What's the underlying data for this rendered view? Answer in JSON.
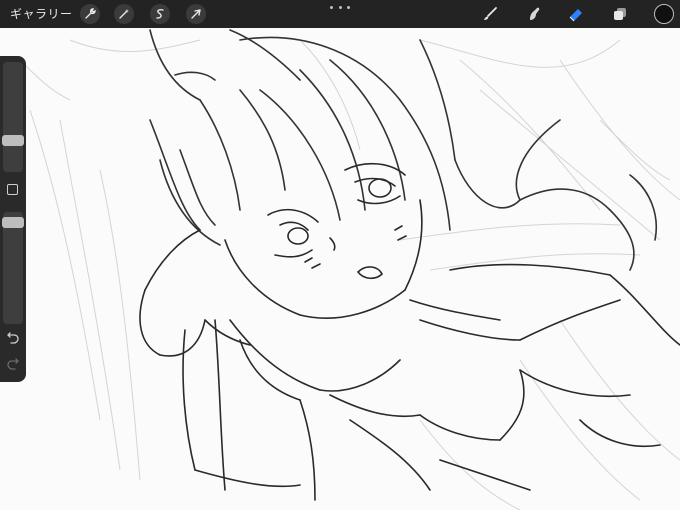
{
  "toolbar": {
    "gallery_label": "ギャラリー",
    "actions_icon": "wrench-icon",
    "adjustments_icon": "magic-wand-icon",
    "selection_icon": "selection-s-icon",
    "transform_icon": "cursor-arrow-icon",
    "more_icon": "more-dots-icon",
    "brush_icon": "brush-icon",
    "smudge_icon": "smudge-icon",
    "eraser_icon": "eraser-icon",
    "layers_icon": "layers-icon",
    "active_tool": "eraser",
    "accent_color": "#2f80ff",
    "current_color": "#101010"
  },
  "sidebar": {
    "brush_size_level": 0.22,
    "opacity_level": 0.08,
    "modifier_icon": "square-modifier-icon",
    "undo_icon": "undo-icon",
    "redo_icon": "redo-icon"
  },
  "canvas": {
    "content": "sketch-artwork"
  }
}
